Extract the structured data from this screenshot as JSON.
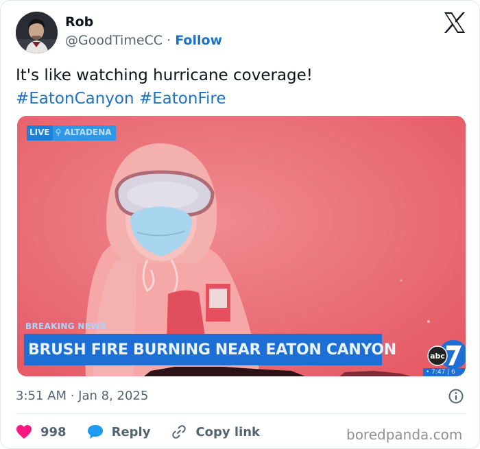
{
  "author": {
    "name": "Rob",
    "handle": "@GoodTimeCC",
    "separator": " · ",
    "follow_label": "Follow"
  },
  "tweet": {
    "text": "It's like watching hurricane coverage!",
    "hashtags": [
      "#EatonCanyon",
      "#EatonFire"
    ]
  },
  "media": {
    "live_label": "LIVE",
    "location_label": "ALTADENA",
    "breaking_label": "BREAKING NEWS",
    "headline": "BRUSH FIRE BURNING NEAR EATON CANYON",
    "network_label": "abc",
    "network_number": "7",
    "time_label": "• 7:47 | 6",
    "tint_color": "#e9646e",
    "bar_color": "#1d6fd6"
  },
  "meta": {
    "timestamp": "3:51 AM · Jan 8, 2025"
  },
  "actions": {
    "like_count": "998",
    "reply_label": "Reply",
    "copy_label": "Copy link"
  },
  "watermark": "boredpanda.com",
  "colors": {
    "link": "#1d72c7",
    "heart": "#f91880",
    "reply_bubble": "#1d9bf0",
    "muted": "#536471"
  },
  "icons": [
    "x-logo-icon",
    "info-icon",
    "heart-icon",
    "reply-bubble-icon",
    "link-icon"
  ]
}
